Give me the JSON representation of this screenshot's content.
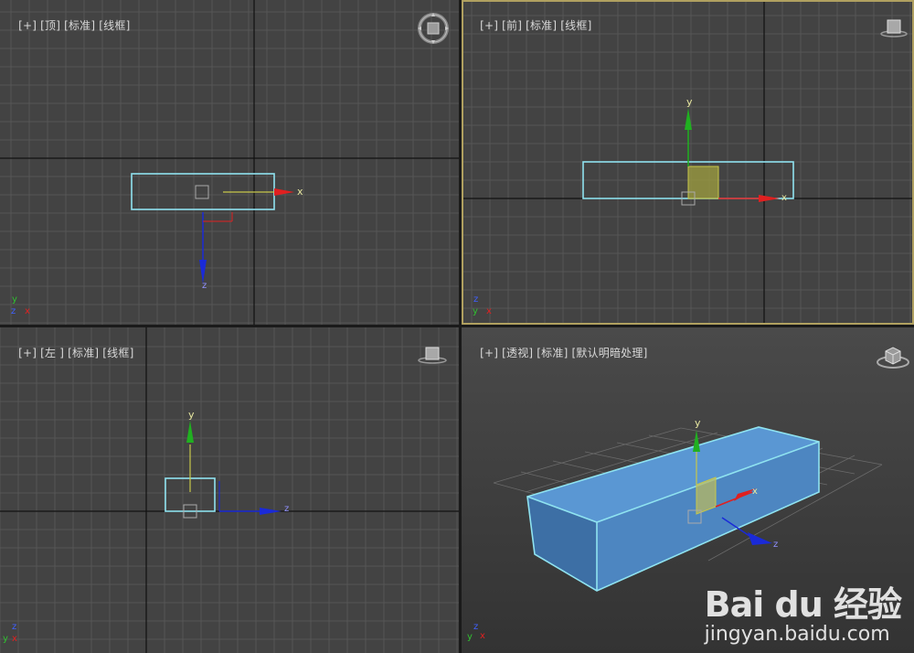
{
  "viewports": {
    "top": {
      "plus": "[+]",
      "name": "[顶]",
      "shading": "[标准]",
      "mode": "[线框]"
    },
    "front": {
      "plus": "[+]",
      "name": "[前]",
      "shading": "[标准]",
      "mode": "[线框]"
    },
    "left": {
      "plus": "[+]",
      "name": "[左 ]",
      "shading": "[标准]",
      "mode": "[线框]"
    },
    "perspective": {
      "plus": "[+]",
      "name": "[透视]",
      "shading": "[标准]",
      "mode": "[默认明暗处理]"
    }
  },
  "gizmo_axes": {
    "x": "x",
    "y": "y",
    "z": "z"
  },
  "corner_axes": {
    "x": "x",
    "y": "y",
    "z": "z"
  },
  "watermark": {
    "logo": "Bai du 经验",
    "url": "jingyan.baidu.com"
  },
  "colors": {
    "viewport_bg": "#434343",
    "grid": "#565656",
    "axis_line": "#111111",
    "selection": "#8fe3f0",
    "x_axis": "#e02020",
    "y_axis": "#20b020",
    "z_axis": "#1a2ad8",
    "gizmo_plane": "#c8c84a",
    "active_border": "#b0a060",
    "box_front": "#4d86c1",
    "box_top": "#5a97d3",
    "box_side": "#3d6fa5"
  },
  "icons": {
    "top_navcube": "compass-ring-icon",
    "front_navcube": "viewcube-icon",
    "left_navcube": "viewcube-icon",
    "perspective_navcube": "viewcube-icon"
  }
}
